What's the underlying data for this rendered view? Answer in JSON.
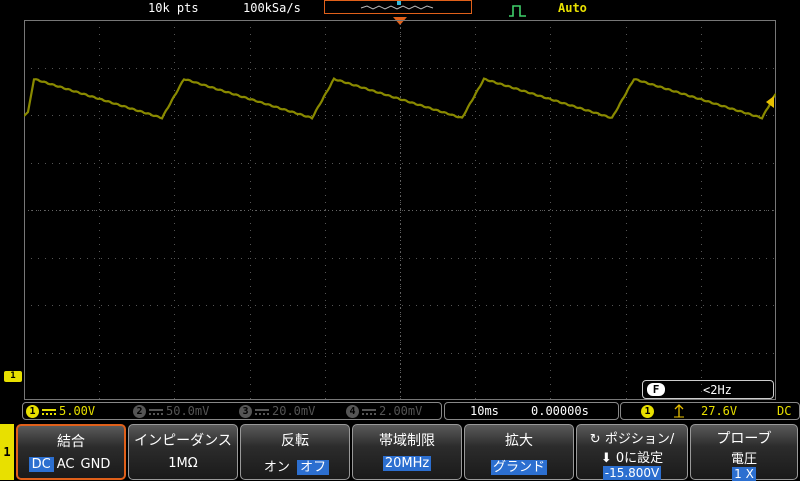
{
  "top": {
    "record_length": "10k pts",
    "sample_rate": "100kSa/s",
    "trigger_mode": "Auto",
    "edge_icon": "rising-edge-icon"
  },
  "waveform": {
    "trace_color": "#8a8a00",
    "description_color": "#e8e000"
  },
  "channel_marker": "1",
  "filter": {
    "badge": "F",
    "value": "<2Hz"
  },
  "status": {
    "ch1": {
      "num": "1",
      "scale": "5.00V"
    },
    "ch2": {
      "num": "2",
      "scale": "50.0mV"
    },
    "ch3": {
      "num": "3",
      "scale": "20.0mV"
    },
    "ch4": {
      "num": "4",
      "scale": "2.00mV"
    },
    "timebase": "10ms",
    "hpos": "0.00000s",
    "trig_ch": "1",
    "trig_level": "27.6V",
    "trig_coupling": "DC"
  },
  "menu": {
    "tab": "1",
    "coupling": {
      "label": "結合",
      "opts": [
        "DC",
        "AC",
        "GND"
      ],
      "selected": "DC"
    },
    "impedance": {
      "label": "インピーダンス",
      "value": "1MΩ"
    },
    "invert": {
      "label": "反転",
      "on": "オン",
      "off": "オフ",
      "selected": "オフ"
    },
    "bandwidth": {
      "label": "帯域制限",
      "value": "20MHz"
    },
    "expand": {
      "label": "拡大",
      "value": "グランド"
    },
    "position": {
      "label": "ポジション/",
      "line2": "0に設定",
      "value": "-15.800V"
    },
    "probe": {
      "label": "プローブ",
      "line2": "電圧",
      "value": "1 X"
    }
  }
}
